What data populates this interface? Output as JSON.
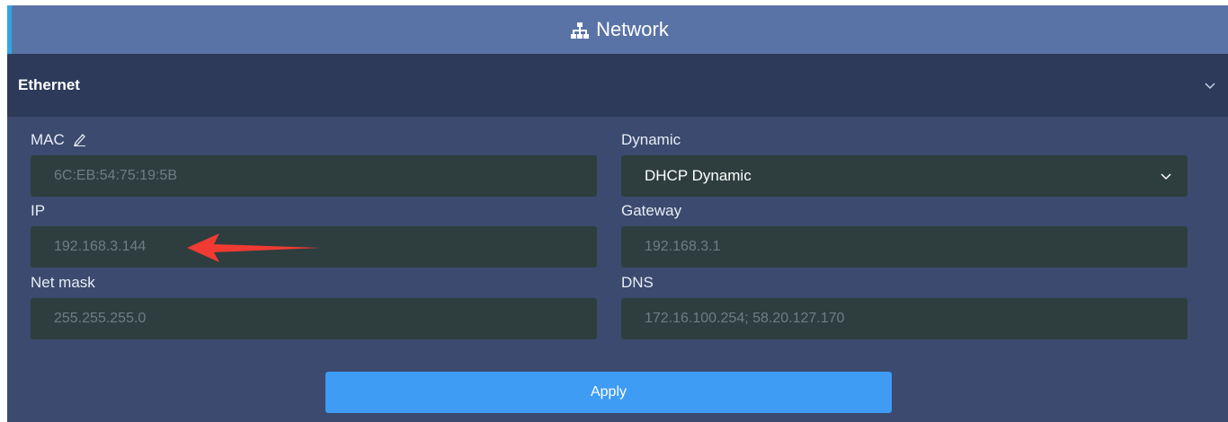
{
  "header": {
    "title": "Network",
    "icon": "network-icon"
  },
  "section": {
    "title": "Ethernet",
    "icon": "chevron-down-icon"
  },
  "fields": {
    "mac": {
      "label": "MAC",
      "value": "6C:EB:54:75:19:5B",
      "icon": "edit-pen-icon"
    },
    "ip": {
      "label": "IP",
      "value": "192.168.3.144"
    },
    "netmask": {
      "label": "Net mask",
      "value": "255.255.255.0"
    },
    "dynamic": {
      "label": "Dynamic",
      "value": "DHCP Dynamic"
    },
    "gateway": {
      "label": "Gateway",
      "value": "192.168.3.1"
    },
    "dns": {
      "label": "DNS",
      "value": "172.16.100.254; 58.20.127.170"
    }
  },
  "apply": {
    "label": "Apply"
  },
  "colors": {
    "header_bg": "#5a73a6",
    "accent_bar": "#2fa6e8",
    "section_bg": "#2d3a5a",
    "panel_bg": "#3b4a6e",
    "field_bg": "#2e3e3f",
    "button_bg": "#3e9cf5",
    "annotation_arrow": "#f03a32"
  }
}
